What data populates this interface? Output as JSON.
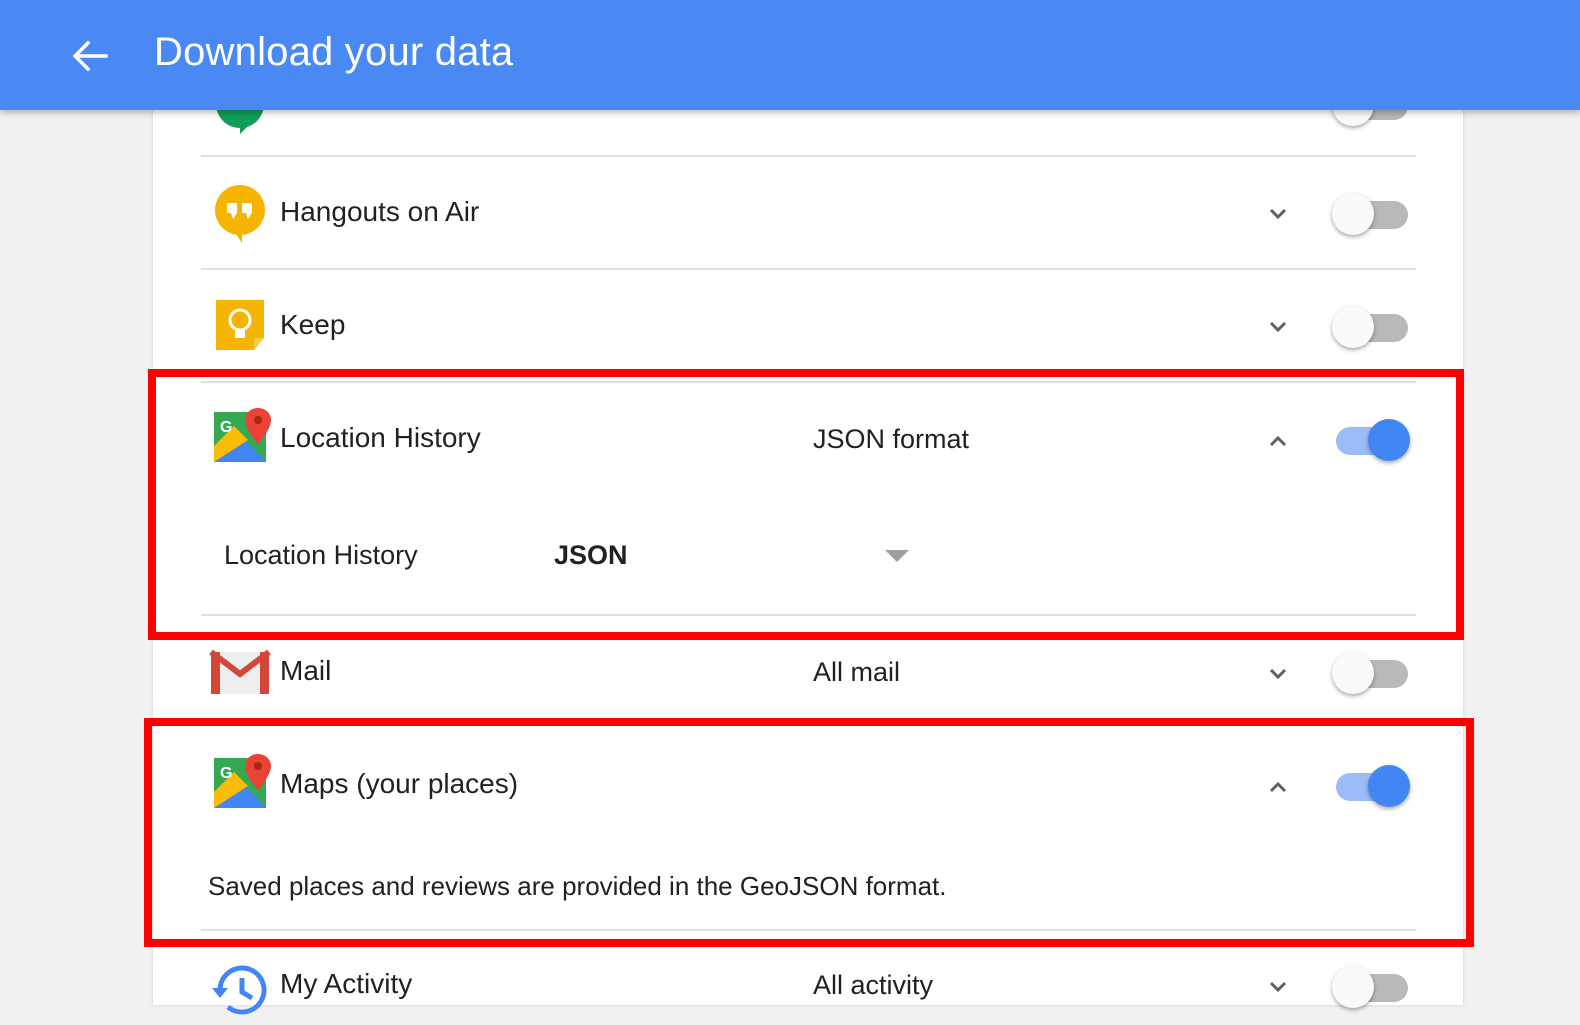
{
  "header": {
    "title": "Download your data",
    "background_color": "#4a89f3"
  },
  "rows": [
    {
      "id": "hangouts",
      "label": "",
      "icon": "hangouts-icon",
      "toggle_on": false
    },
    {
      "id": "hangouts_on_air",
      "label": "Hangouts on Air",
      "format": "",
      "icon": "hangouts-on-air-icon",
      "expanded": false,
      "toggle_on": false
    },
    {
      "id": "keep",
      "label": "Keep",
      "format": "",
      "icon": "keep-icon",
      "expanded": false,
      "toggle_on": false
    },
    {
      "id": "location_history",
      "label": "Location History",
      "format": "JSON format",
      "icon": "maps-icon",
      "expanded": true,
      "toggle_on": true,
      "option": {
        "label": "Location History",
        "value": "JSON"
      }
    },
    {
      "id": "mail",
      "label": "Mail",
      "format": "All mail",
      "icon": "gmail-icon",
      "expanded": false,
      "toggle_on": false
    },
    {
      "id": "maps",
      "label": "Maps (your places)",
      "format": "",
      "icon": "maps-icon",
      "expanded": true,
      "toggle_on": true,
      "note": "Saved places and reviews are provided in the GeoJSON format."
    },
    {
      "id": "my_activity",
      "label": "My Activity",
      "format": "All activity",
      "icon": "my-activity-icon",
      "expanded": false,
      "toggle_on": false
    }
  ],
  "colors": {
    "highlight": "#ff0000",
    "toggle_on": "#4285f4",
    "toggle_off": "#b9b9b9"
  }
}
